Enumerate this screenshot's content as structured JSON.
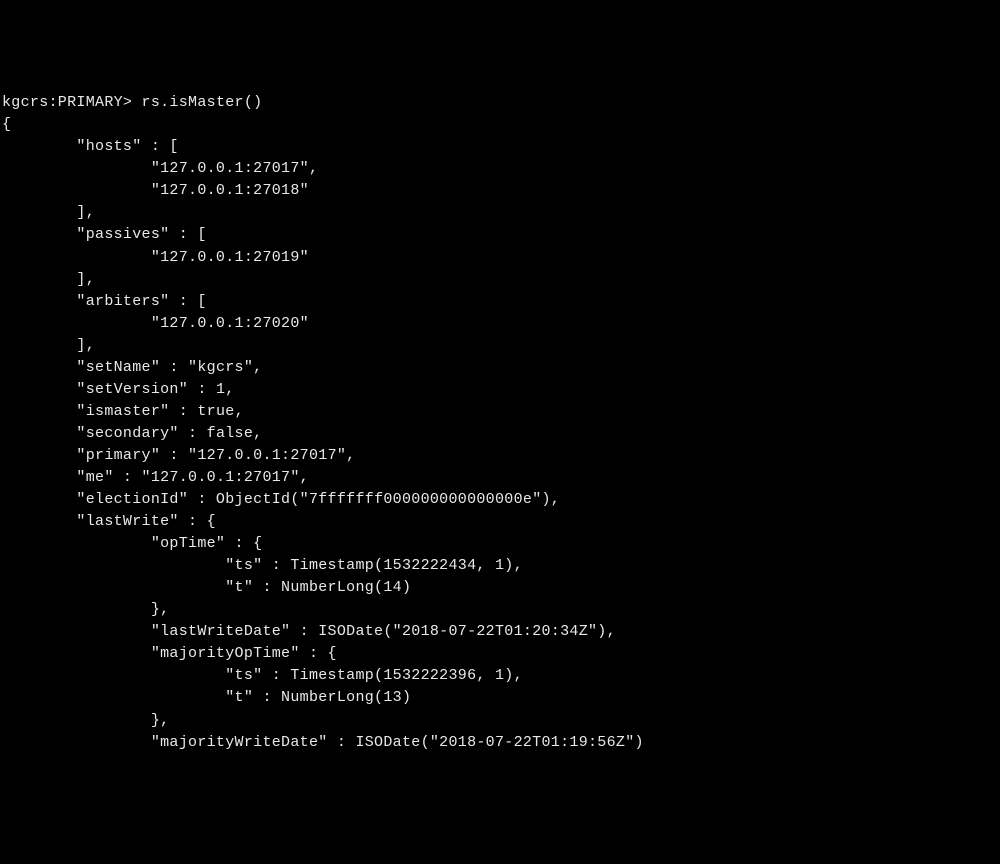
{
  "prompt": "kgcrs:PRIMARY> ",
  "command": "rs.isMaster()",
  "result": {
    "hosts": [
      "127.0.0.1:27017",
      "127.0.0.1:27018"
    ],
    "passives": [
      "127.0.0.1:27019"
    ],
    "arbiters": [
      "127.0.0.1:27020"
    ],
    "setName": "kgcrs",
    "setVersion": 1,
    "ismaster": true,
    "secondary": false,
    "primary": "127.0.0.1:27017",
    "me": "127.0.0.1:27017",
    "electionId": "7fffffff000000000000000e",
    "lastWrite": {
      "opTime": {
        "ts_args": "1532222434, 1",
        "t_val": "14"
      },
      "lastWriteDate": "2018-07-22T01:20:34Z",
      "majorityOpTime": {
        "ts_args": "1532222396, 1",
        "t_val": "13"
      },
      "majorityWriteDate": "2018-07-22T01:19:56Z"
    }
  }
}
